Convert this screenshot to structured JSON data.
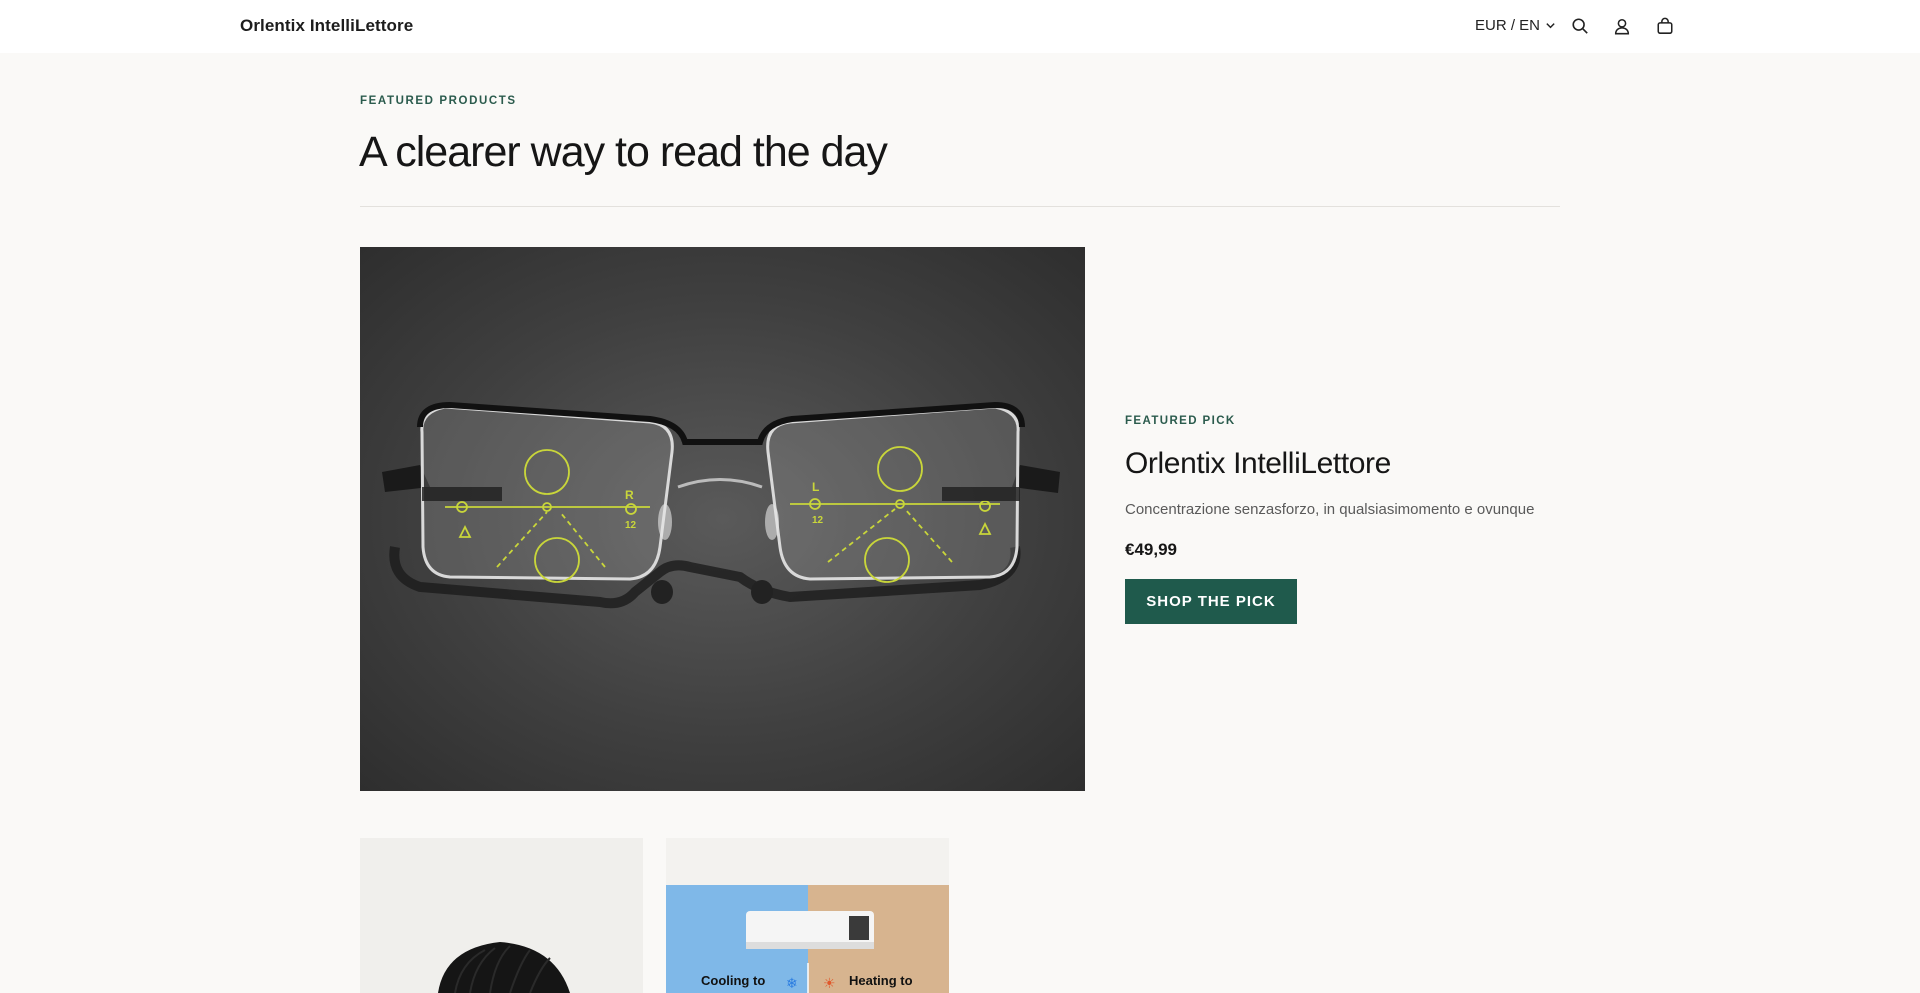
{
  "header": {
    "brand": "Orlentix IntelliLettore",
    "locale_label": "EUR / EN",
    "icons": [
      "search-icon",
      "account-icon",
      "cart-icon"
    ]
  },
  "section": {
    "eyebrow": "FEATURED PRODUCTS",
    "headline": "A clearer way to read the day"
  },
  "featured": {
    "eyebrow": "FEATURED PICK",
    "title": "Orlentix IntelliLettore",
    "description": "Concentrazione senzasforzo, in qualsiasimomento e ovunque",
    "price": "€49,99",
    "button_label": "SHOP THE PICK",
    "lens_marks": [
      "R",
      "12",
      "L",
      "12"
    ]
  },
  "cards": [
    {
      "image": "black-beanie"
    },
    {
      "image": "air-conditioner",
      "caption_left": "Cooling to",
      "caption_right": "Heating to"
    }
  ],
  "colors": {
    "accent": "#1f5a4c",
    "eyebrow": "#2b5b4d",
    "background": "#faf9f7"
  }
}
